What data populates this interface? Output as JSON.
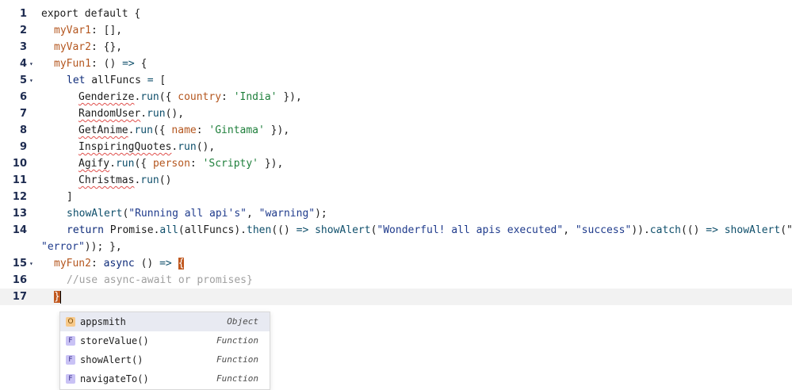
{
  "gutter": {
    "line_numbers": [
      "1",
      "2",
      "3",
      "4",
      "5",
      "6",
      "7",
      "8",
      "9",
      "10",
      "11",
      "12",
      "13",
      "14",
      "15",
      "16",
      "17"
    ],
    "fold_marker": "▾"
  },
  "code": {
    "l1": [
      "export default {"
    ],
    "l2": [
      "myVar1",
      ": [],"
    ],
    "l3": [
      "myVar2",
      ": {},"
    ],
    "l4": [
      "myFun1",
      ": () ",
      "=>",
      " {"
    ],
    "l5": [
      "let",
      " allFuncs ",
      "=",
      " ["
    ],
    "l6": [
      "Genderize",
      ".",
      "run",
      "({ ",
      "country",
      ": ",
      "'India'",
      " }),"
    ],
    "l7": [
      "RandomUser",
      ".",
      "run",
      "(),"
    ],
    "l8": [
      "GetAnime",
      ".",
      "run",
      "({ ",
      "name",
      ": ",
      "'Gintama'",
      " }),"
    ],
    "l9": [
      "InspiringQuotes",
      ".",
      "run",
      "(),"
    ],
    "l10": [
      "Agify",
      ".",
      "run",
      "({ ",
      "person",
      ": ",
      "'Scripty'",
      " }),"
    ],
    "l11": [
      "Christmas",
      ".",
      "run",
      "()"
    ],
    "l12": [
      "]"
    ],
    "l13": [
      "showAlert",
      "(",
      "\"Running all api's\"",
      ", ",
      "\"warning\"",
      ");"
    ],
    "l14": [
      "return",
      " Promise.",
      "all",
      "(allFuncs).",
      "then",
      "(() ",
      "=>",
      " ",
      "showAlert",
      "(",
      "\"Wonderful! all apis executed\"",
      ", ",
      "\"success\"",
      ")).",
      "catch",
      "(() ",
      "=>",
      " ",
      "showAlert",
      "(\""
    ],
    "l14b": [
      "\"error\"",
      ")); },"
    ],
    "l15": [
      "myFun2",
      ": ",
      "async",
      " () ",
      "=>",
      " ",
      "{"
    ],
    "l16": [
      "//use async-await or promises}"
    ],
    "l17": [
      "}"
    ]
  },
  "autocomplete": {
    "items": [
      {
        "badge": "O",
        "name": "appsmith",
        "type": "Object"
      },
      {
        "badge": "F",
        "name": "storeValue()",
        "type": "Function"
      },
      {
        "badge": "F",
        "name": "showAlert()",
        "type": "Function"
      },
      {
        "badge": "F",
        "name": "navigateTo()",
        "type": "Function"
      }
    ]
  }
}
